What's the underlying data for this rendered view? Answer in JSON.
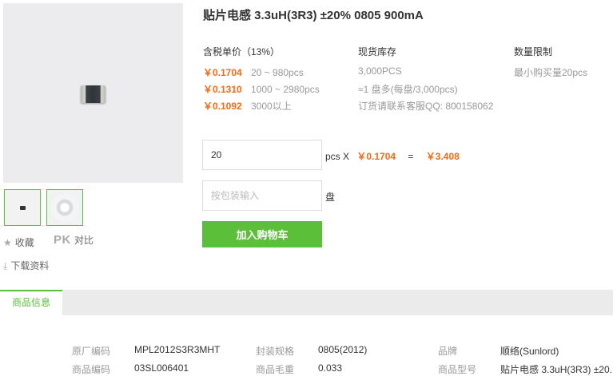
{
  "title": "贴片电感 3.3uH(3R3) ±20% 0805 900mA",
  "sidebar": {
    "favorite": "收藏",
    "pk_badge": "PK",
    "compare": "对比",
    "download": "下载资料"
  },
  "pricing": {
    "header": "含税单价（13%）",
    "tiers": [
      {
        "price": "￥0.1704",
        "range": "20 ~ 980pcs"
      },
      {
        "price": "￥0.1310",
        "range": "1000 ~ 2980pcs"
      },
      {
        "price": "￥0.1092",
        "range": "3000以上"
      }
    ]
  },
  "stock": {
    "header": "现货库存",
    "quantity": "3,000PCS",
    "reel": "≈1 盘多(每盘/3,000pcs)",
    "contact": "订货请联系客服QQ: 800158062"
  },
  "limit": {
    "header": "数量限制",
    "min": "最小购买量20pcs"
  },
  "order": {
    "qty_value": "20",
    "unit": "pcs X",
    "unit_price": "￥0.1704",
    "equals": "=",
    "total": "￥3.408",
    "reel_placeholder": "按包装输入",
    "reel_unit": "盘",
    "add_cart": "加入购物车"
  },
  "tabs": {
    "product_info": "商品信息"
  },
  "specs": [
    {
      "label": "原厂编码",
      "value": "MPL2012S3R3MHT"
    },
    {
      "label": "封装规格",
      "value": "0805(2012)"
    },
    {
      "label": "品牌",
      "value": "顺络(Sunlord)"
    },
    {
      "label": "商品编码",
      "value": "03SL006401"
    },
    {
      "label": "商品毛重",
      "value": "0.033"
    },
    {
      "label": "商品型号",
      "value": "贴片电感 3.3uH(3R3) ±20."
    }
  ]
}
